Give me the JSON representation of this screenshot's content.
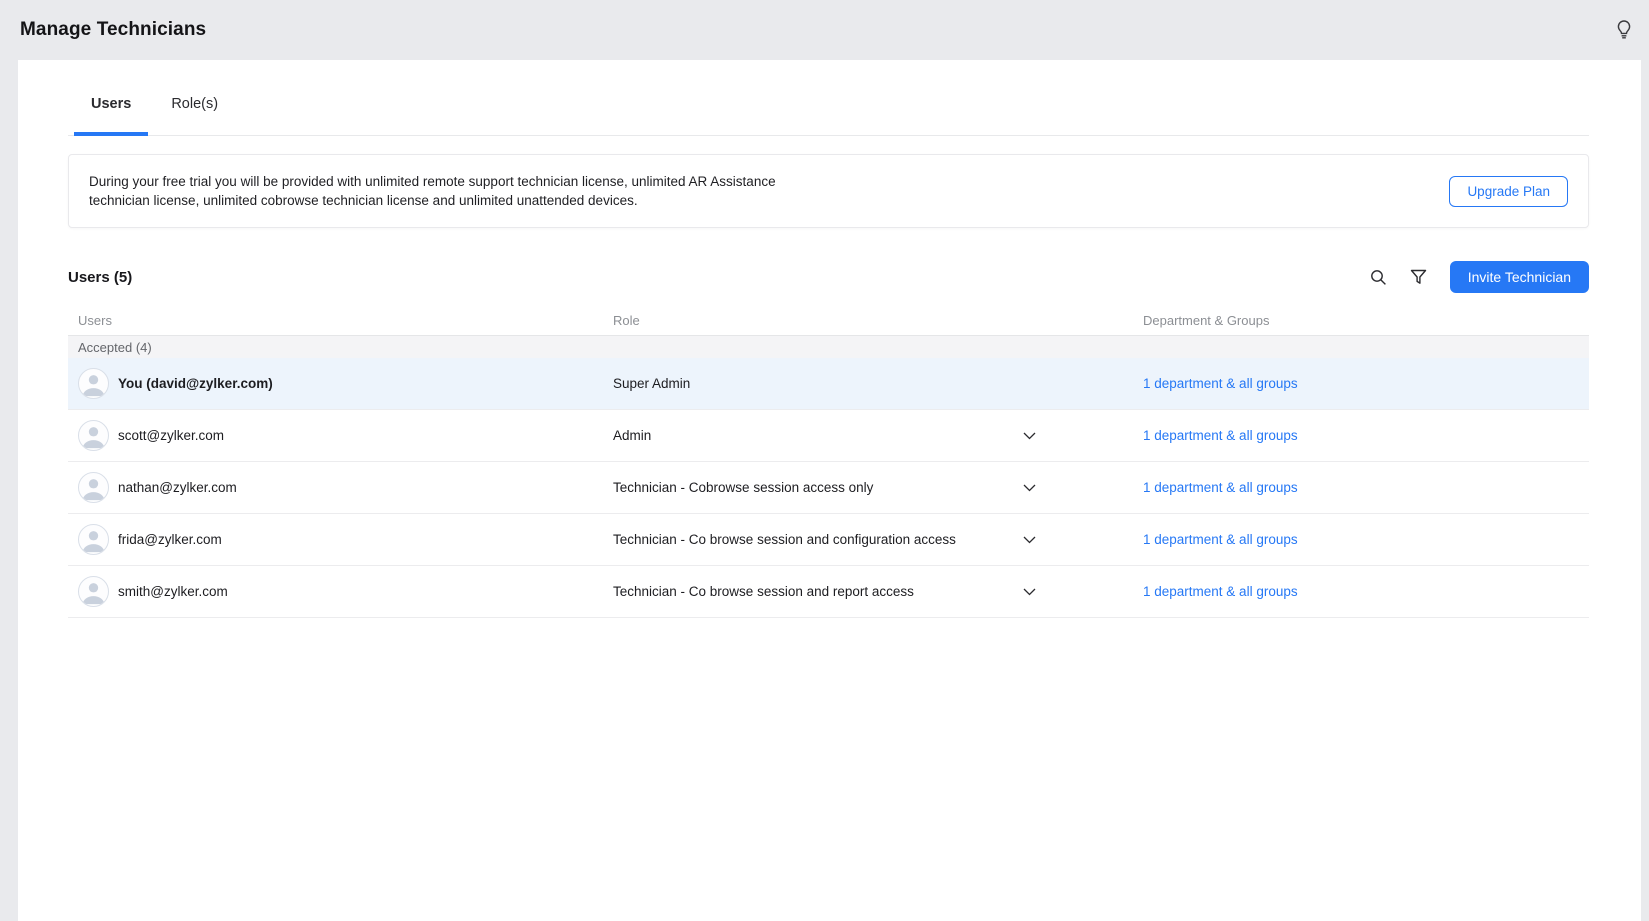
{
  "colors": {
    "accent": "#2678f5",
    "page_bg": "#e9eaed",
    "row_highlight": "#edf4fc",
    "group_bar_bg": "#f4f4f6"
  },
  "header": {
    "title": "Manage Technicians"
  },
  "tabs": [
    {
      "label": "Users",
      "active": true
    },
    {
      "label": "Role(s)",
      "active": false
    }
  ],
  "trial_banner": {
    "text": "During your free trial you will be provided with unlimited remote support technician license, unlimited AR Assistance technician license, unlimited cobrowse technician license and unlimited unattended devices.",
    "button_label": "Upgrade Plan"
  },
  "users_section": {
    "title": "Users (5)",
    "invite_button_label": "Invite Technician",
    "columns": {
      "users": "Users",
      "role": "Role",
      "dept": "Department & Groups"
    },
    "group_header": "Accepted (4)",
    "rows": [
      {
        "name": "You (david@zylker.com)",
        "role": "Super Admin",
        "dept": "1 department & all groups",
        "expandable": false,
        "highlighted": true
      },
      {
        "name": "scott@zylker.com",
        "role": "Admin",
        "dept": "1 department & all groups",
        "expandable": true,
        "highlighted": false
      },
      {
        "name": "nathan@zylker.com",
        "role": "Technician - Cobrowse session access only",
        "dept": "1 department & all groups",
        "expandable": true,
        "highlighted": false
      },
      {
        "name": "frida@zylker.com",
        "role": "Technician - Co browse session and configuration access",
        "dept": "1 department & all groups",
        "expandable": true,
        "highlighted": false
      },
      {
        "name": "smith@zylker.com",
        "role": "Technician - Co browse session and report access",
        "dept": "1 department & all groups",
        "expandable": true,
        "highlighted": false
      }
    ]
  }
}
